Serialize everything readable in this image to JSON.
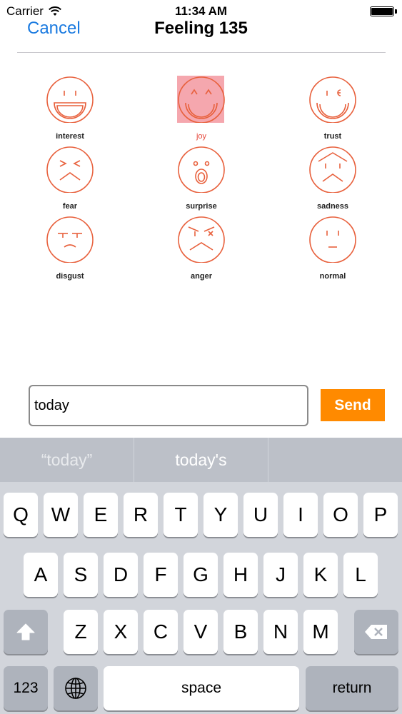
{
  "status_bar": {
    "carrier": "Carrier",
    "time": "11:34 AM"
  },
  "nav": {
    "cancel_label": "Cancel",
    "title": "Feeling 135"
  },
  "colors": {
    "accent_blue": "#1a7ae0",
    "emotion_stroke": "#e8603c",
    "selected_bg": "#f5a7ae",
    "selected_label": "#e5473b",
    "send_bg": "#ff8a00"
  },
  "emotions": [
    {
      "label": "interest",
      "icon": "interest-face-icon"
    },
    {
      "label": "joy",
      "icon": "joy-face-icon",
      "selected": true
    },
    {
      "label": "trust",
      "icon": "trust-face-icon"
    },
    {
      "label": "fear",
      "icon": "fear-face-icon"
    },
    {
      "label": "surprise",
      "icon": "surprise-face-icon"
    },
    {
      "label": "sadness",
      "icon": "sadness-face-icon"
    },
    {
      "label": "disgust",
      "icon": "disgust-face-icon"
    },
    {
      "label": "anger",
      "icon": "anger-face-icon"
    },
    {
      "label": "normal",
      "icon": "normal-face-icon"
    }
  ],
  "composer": {
    "input_value": "today",
    "send_label": "Send"
  },
  "keyboard": {
    "suggestions": [
      "“today”",
      "today's",
      ""
    ],
    "row1": [
      "Q",
      "W",
      "E",
      "R",
      "T",
      "Y",
      "U",
      "I",
      "O",
      "P"
    ],
    "row2": [
      "A",
      "S",
      "D",
      "F",
      "G",
      "H",
      "J",
      "K",
      "L"
    ],
    "row3": [
      "Z",
      "X",
      "C",
      "V",
      "B",
      "N",
      "M"
    ],
    "numbers_label": "123",
    "space_label": "space",
    "return_label": "return",
    "shift_icon": "shift-arrow-icon",
    "delete_icon": "backspace-icon",
    "globe_icon": "globe-icon"
  }
}
